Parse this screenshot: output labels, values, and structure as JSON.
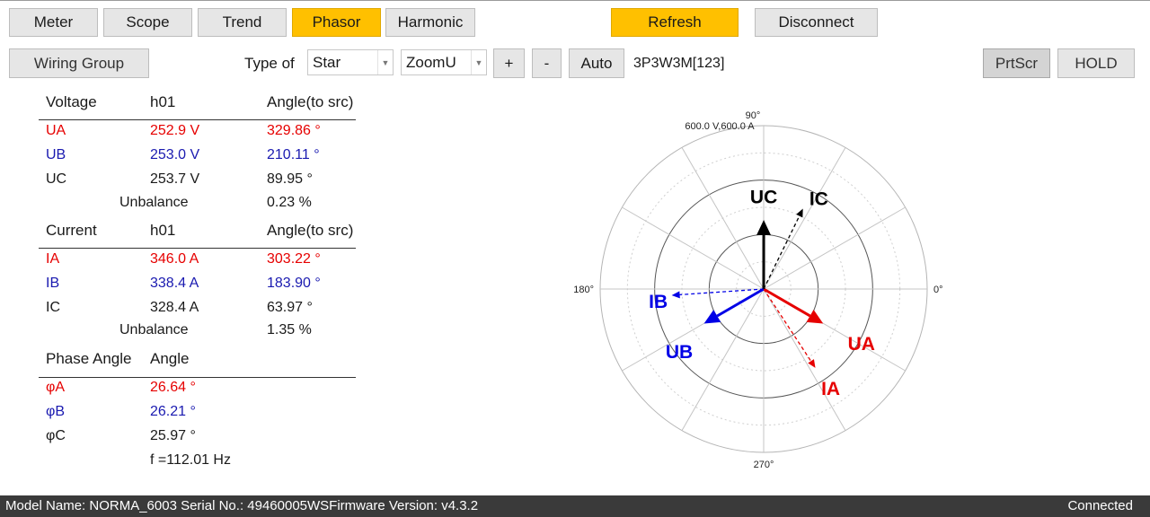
{
  "toolbar": {
    "meter": "Meter",
    "scope": "Scope",
    "trend": "Trend",
    "phasor": "Phasor",
    "harmonic": "Harmonic",
    "refresh": "Refresh",
    "disconnect": "Disconnect",
    "active_tab": "Phasor"
  },
  "controls": {
    "wiring_group": "Wiring Group",
    "type_of_label": "Type of",
    "type_value": "Star",
    "zoom_value": "ZoomU",
    "plus": "+",
    "minus": "-",
    "auto": "Auto",
    "wiring_mode": "3P3W3M[123]",
    "prtscr": "PrtScr",
    "hold": "HOLD"
  },
  "voltage": {
    "header": [
      "Voltage",
      "h01",
      "Angle(to src)"
    ],
    "rows": [
      {
        "name": "UA",
        "value": "252.9 V",
        "angle": "329.86 °"
      },
      {
        "name": "UB",
        "value": "253.0 V",
        "angle": "210.11 °"
      },
      {
        "name": "UC",
        "value": "253.7 V",
        "angle": "89.95 °"
      }
    ],
    "unbalance_label": "Unbalance",
    "unbalance_value": "0.23 %"
  },
  "current": {
    "header": [
      "Current",
      "h01",
      "Angle(to src)"
    ],
    "rows": [
      {
        "name": "IA",
        "value": "346.0 A",
        "angle": "303.22 °"
      },
      {
        "name": "IB",
        "value": "338.4 A",
        "angle": "183.90 °"
      },
      {
        "name": "IC",
        "value": "328.4 A",
        "angle": "63.97 °"
      }
    ],
    "unbalance_label": "Unbalance",
    "unbalance_value": "1.35 %"
  },
  "phase_angle": {
    "header": [
      "Phase Angle",
      "Angle"
    ],
    "rows": [
      {
        "name": "φA",
        "angle": "26.64 °"
      },
      {
        "name": "φB",
        "angle": "26.21 °"
      },
      {
        "name": "φC",
        "angle": "25.97 °"
      }
    ],
    "frequency": "f =112.01 Hz"
  },
  "phasor_diagram": {
    "scale_label": "600.0 V,600.0 A",
    "angle_labels": {
      "a90": "90°",
      "a0": "0°",
      "a180": "180°",
      "a270": "270°"
    },
    "ring_count": 3,
    "spoke_step_deg": 30,
    "vectors": [
      {
        "label": "UA",
        "angle_deg": 329.86,
        "magnitude": 0.421,
        "color": "#e60000",
        "style": "solid"
      },
      {
        "label": "UB",
        "angle_deg": 210.11,
        "magnitude": 0.422,
        "color": "#0000e6",
        "style": "solid"
      },
      {
        "label": "UC",
        "angle_deg": 89.95,
        "magnitude": 0.423,
        "color": "#000000",
        "style": "solid"
      },
      {
        "label": "IA",
        "angle_deg": 303.22,
        "magnitude": 0.577,
        "color": "#e60000",
        "style": "dashed"
      },
      {
        "label": "IB",
        "angle_deg": 183.9,
        "magnitude": 0.564,
        "color": "#0000e6",
        "style": "dashed"
      },
      {
        "label": "IC",
        "angle_deg": 63.97,
        "magnitude": 0.547,
        "color": "#000000",
        "style": "dashed"
      }
    ]
  },
  "status_bar": {
    "model": "Model Name:  NORMA_6003 Serial No.:  49460005WSFirmware Version:  v4.3.2",
    "connection": "Connected"
  },
  "colors": {
    "accent": "#ffc000",
    "phase_a": "#e60000",
    "phase_b": "#1a1ab0",
    "status_bg": "#3a3a3a"
  }
}
